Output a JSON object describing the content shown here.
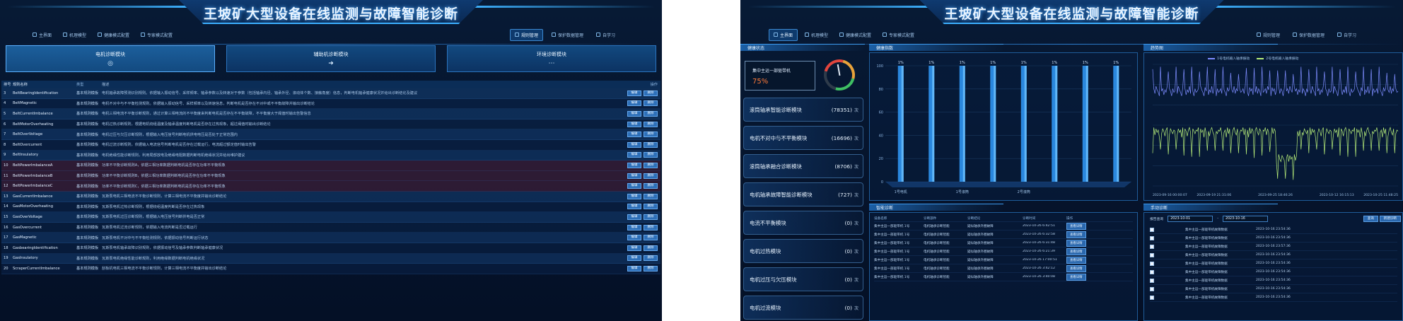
{
  "title": "王坡矿大型设备在线监测与故障智能诊断",
  "left": {
    "nav": [
      {
        "label": "主界面",
        "icon": "home-icon"
      },
      {
        "label": "机理模型",
        "icon": "model-icon"
      },
      {
        "label": "健康模式配置",
        "icon": "config-icon"
      },
      {
        "label": "专家模式配置",
        "icon": "expert-icon"
      }
    ],
    "nav_right": [
      {
        "label": "规则管理",
        "icon": "rule-icon",
        "active": true
      },
      {
        "label": "保护数据管理",
        "icon": "data-icon"
      },
      {
        "label": "自学习",
        "icon": "learn-icon"
      }
    ],
    "modules": [
      {
        "label": "电机诊断模块",
        "icon": "◎"
      },
      {
        "label": "辅助机诊断模块",
        "icon": "➜"
      },
      {
        "label": "环境诊断模块",
        "icon": "⋯"
      }
    ],
    "table": {
      "headers": [
        "排号",
        "规则名称",
        "类型",
        "描述",
        "操作"
      ],
      "op_labels": [
        "编辑",
        "删除"
      ],
      "rows": [
        {
          "no": "3",
          "name": "BeltBearingIdentification",
          "type": "基本规则模板",
          "desc": "电机轴承故障预测识别规则。依据输入振动信号、采样频率、轴承参数以及转速对于参数（包括轴承内径、轴承外径、滚动体个数、接触角度）信息，判断电机轴承健康状况并给出诊断结论及建议"
        },
        {
          "no": "4",
          "name": "BeltMagnetic",
          "type": "基本规则模板",
          "desc": "电机不对中与不平衡检测规则。依据输入振动信号、采样频率以及转速信息，判断电机是否存在不对中或不平衡故障并输出诊断结论"
        },
        {
          "no": "5",
          "name": "BeltCurrentImbalance",
          "type": "基本规则模板",
          "desc": "电机三相电流不平衡诊断规则，通过计算三相电流的不平衡度来判断电机是否存在不平衡故障，不平衡度大于阈值时输出告警信息"
        },
        {
          "no": "6",
          "name": "BeltMotorOverheating",
          "type": "基本规则模板",
          "desc": "电机过热诊断规则，根据电机绕组温度及轴承温度判断电机是否存在过热现象，超过阈值时输出诊断结论"
        },
        {
          "no": "7",
          "name": "BeltOverVoltage",
          "type": "基本规则模板",
          "desc": "电机过压与欠压诊断规则，根据输入电压信号判断电机供电电压是否处于正常范围内"
        },
        {
          "no": "8",
          "name": "BeltOvercurrent",
          "type": "基本规则模板",
          "desc": "电机过流诊断规则，依据输入电流信号判断电机是否存在过载运行，电流超过额定值时输出告警"
        },
        {
          "no": "9",
          "name": "BeltInsulatory",
          "type": "基本规则模板",
          "desc": "电机绝缘性能诊断规则，利用局部放电及绝缘电阻数据判断电机绝缘状况并给出维护建议"
        },
        {
          "no": "10",
          "name": "BeltPowerImbalanceA",
          "type": "基本规则模板",
          "desc": "功率不平衡诊断规则A，依据三相功率数据判断电机是否存在功率不平衡现象"
        },
        {
          "no": "11",
          "name": "BeltPowerImbalanceB",
          "type": "基本规则模板",
          "desc": "功率不平衡诊断规则B，依据三相功率数据判断电机是否存在功率不平衡现象"
        },
        {
          "no": "12",
          "name": "BeltPowerImbalanceC",
          "type": "基本规则模板",
          "desc": "功率不平衡诊断规则C，依据三相功率数据判断电机是否存在功率不平衡现象"
        },
        {
          "no": "13",
          "name": "GasCurrentImbalance",
          "type": "基本规则模板",
          "desc": "瓦斯泵电机三相电流不平衡诊断规则，计算三相电流不平衡度并输出诊断结论"
        },
        {
          "no": "14",
          "name": "GasMotorOverheating",
          "type": "基本规则模板",
          "desc": "瓦斯泵电机过热诊断规则，根据绕组温度判断是否存在过热现象"
        },
        {
          "no": "15",
          "name": "GasOverVoltage",
          "type": "基本规则模板",
          "desc": "瓦斯泵电机过压诊断规则，根据输入电压信号判断供电是否正常"
        },
        {
          "no": "16",
          "name": "GasOvercurrent",
          "type": "基本规则模板",
          "desc": "瓦斯泵电机过流诊断规则，依据输入电流判断是否过载运行"
        },
        {
          "no": "17",
          "name": "GasMagnetic",
          "type": "基本规则模板",
          "desc": "瓦斯泵电机不对中与不平衡检测规则，依据振动信号判断运行状态"
        },
        {
          "no": "18",
          "name": "GasbearingIdentification",
          "type": "基本规则模板",
          "desc": "瓦斯泵电机轴承故障识别规则，依据振动信号及轴承参数判断轴承健康状况"
        },
        {
          "no": "19",
          "name": "GasInsulatory",
          "type": "基本规则模板",
          "desc": "瓦斯泵电机绝缘性能诊断规则，利用绝缘数据判断电机绝缘状况"
        },
        {
          "no": "20",
          "name": "ScraperCurrentImbalance",
          "type": "基本规则模板",
          "desc": "刮板机电机三相电流不平衡诊断规则，计算三相电流不平衡度并输出诊断结论"
        }
      ]
    }
  },
  "right": {
    "nav": [
      {
        "label": "主界面",
        "icon": "home-icon",
        "active": true
      },
      {
        "label": "机理模型",
        "icon": "model-icon"
      },
      {
        "label": "健康模式配置",
        "icon": "config-icon"
      },
      {
        "label": "专家模式配置",
        "icon": "expert-icon"
      }
    ],
    "nav_right": [
      {
        "label": "规则管理",
        "icon": "rule-icon"
      },
      {
        "label": "保护数据管理",
        "icon": "data-icon"
      },
      {
        "label": "自学习",
        "icon": "learn-icon"
      }
    ],
    "health_panel": {
      "title": "健康状态",
      "device": "集中主运一部驱带机",
      "percent": "75%"
    },
    "faults": [
      {
        "label": "滚筒轴承智能诊断模块",
        "count": "(78351)",
        "unit": "次"
      },
      {
        "label": "电机不对中与不平衡模块",
        "count": "(16696)",
        "unit": "次"
      },
      {
        "label": "滚筒轴承融合诊断模块",
        "count": "(8706)",
        "unit": "次"
      },
      {
        "label": "电机轴承故障智能诊断模块",
        "count": "(727)",
        "unit": "次"
      },
      {
        "label": "电流不平衡模块",
        "count": "(0)",
        "unit": "次"
      },
      {
        "label": "电机过热模块",
        "count": "(0)",
        "unit": "次"
      },
      {
        "label": "电机过压与欠压模块",
        "count": "(0)",
        "unit": "次"
      },
      {
        "label": "电机过流模块",
        "count": "(0)",
        "unit": "次"
      }
    ],
    "health_chart_title": "健康指数",
    "trend_title": "趋势图",
    "trend_legend": [
      "1号电机输入轴承振动",
      "2号电机输入轴承振动"
    ],
    "diagnosis_title": "智能诊断",
    "diagnosis_headers": [
      "设备名称",
      "诊断部件",
      "诊断结论",
      "诊断时间",
      "操作"
    ],
    "diagnosis_rows": [
      {
        "device": "集中主运一部驱带机 1号",
        "part": "电机轴承诊断智能",
        "result": "疑似轴承外圈故障",
        "time": "2023-10-26 6:42:51",
        "op": "查看详情"
      },
      {
        "device": "集中主运一部驱带机 1号",
        "part": "电机轴承诊断智能",
        "result": "疑似轴承外圈故障",
        "time": "2023-10-26 6:32:58",
        "op": "查看详情"
      },
      {
        "device": "集中主运一部驱带机 1号",
        "part": "电机轴承诊断智能",
        "result": "疑似轴承外圈故障",
        "time": "2023-10-26 6:31:48",
        "op": "查看详情"
      },
      {
        "device": "集中主运一部驱带机 1号",
        "part": "电机轴承诊断智能",
        "result": "疑似轴承外圈故障",
        "time": "2023-10-26 6:21:39",
        "op": "查看详情"
      },
      {
        "device": "集中主运一部驱带机 1号",
        "part": "电机轴承诊断智能",
        "result": "疑似轴承外圈故障",
        "time": "2023-10-26 17:00:51",
        "op": "查看详情"
      },
      {
        "device": "集中主运一部驱带机 1号",
        "part": "电机轴承诊断智能",
        "result": "疑似轴承外圈故障",
        "time": "2023-10-26 3:42:12",
        "op": "查看详情"
      },
      {
        "device": "集中主运一部驱带机 1号",
        "part": "电机轴承诊断智能",
        "result": "疑似轴承外圈故障",
        "time": "2023-10-26 3:40:08",
        "op": "查看详情"
      }
    ],
    "manual_title": "手动诊断",
    "manual_filter_label": "报告查询",
    "date_from": "2023-10-01",
    "date_to": "2023-10-16",
    "query_label": "查询",
    "new_label": "新建诊断",
    "manual_rows": [
      {
        "device": "集中主运一部驱带机故障数据",
        "time": "2023-10-16 23:54:36"
      },
      {
        "device": "集中主运一部驱带机故障数据",
        "time": "2023-10-16 23:54:36"
      },
      {
        "device": "集中主运一部驱带机故障数据",
        "time": "2023-10-16 23:57:36"
      },
      {
        "device": "集中主运一部驱带机故障数据",
        "time": "2023-10-16 23:54:36"
      },
      {
        "device": "集中主运一部驱带机故障数据",
        "time": "2023-10-16 23:54:36"
      },
      {
        "device": "集中主运一部驱带机故障数据",
        "time": "2023-10-16 23:54:36"
      },
      {
        "device": "集中主运一部驱带机故障数据",
        "time": "2023-10-16 23:54:36"
      },
      {
        "device": "集中主运一部驱带机故障数据",
        "time": "2023-10-16 23:54:36"
      },
      {
        "device": "集中主运一部驱带机故障数据",
        "time": "2023-10-16 23:54:36"
      }
    ]
  },
  "chart_data": [
    {
      "type": "bar",
      "categories": [
        "1号电机",
        "",
        "1号滚筒",
        "",
        "2号滚筒",
        "",
        "",
        ""
      ],
      "values": [
        1,
        1,
        1,
        1,
        1,
        1,
        1,
        1
      ],
      "data_labels": [
        "1%",
        "1%",
        "1%",
        "1%",
        "1%",
        "1%",
        "1%",
        "1%"
      ],
      "ylim": [
        0,
        1
      ],
      "ytick_labels": [
        "100",
        "80",
        "60",
        "40",
        "20",
        "0"
      ],
      "title": "",
      "xlabel": "",
      "ylabel": "",
      "grid": true
    },
    {
      "type": "line",
      "x": [
        "2023-09-16 00:00:07",
        "2023-09-19 21:31:06",
        "2023-09-25 18:46:26",
        "2023-10-12 16:15:13",
        "2023-10-25 11:48:25"
      ],
      "series": [
        {
          "name": "1号电机输入轴承振动",
          "color": "#7d8cff",
          "pattern": [
            0.78,
            0.8,
            0.76,
            0.82,
            0.79,
            0.77,
            0.74,
            0.81,
            0.78,
            0.8,
            0.75,
            0.79,
            0.77,
            0.82,
            0.76,
            0.8,
            0.78,
            0.74,
            0.8,
            0.77
          ]
        },
        {
          "name": "2号电机输入轴承振动",
          "color": "#b9f07a",
          "pattern": [
            0.45,
            0.48,
            0.42,
            0.47,
            0.44,
            0.46,
            0.4,
            0.48,
            0.43,
            0.47,
            0.45,
            0.41,
            0.46,
            0.48,
            0.44,
            0.42,
            0.47,
            0.45,
            0.43,
            0.46
          ]
        }
      ],
      "title": "",
      "xlabel": "",
      "ylabel": "",
      "grid": true,
      "legend": "top"
    }
  ]
}
